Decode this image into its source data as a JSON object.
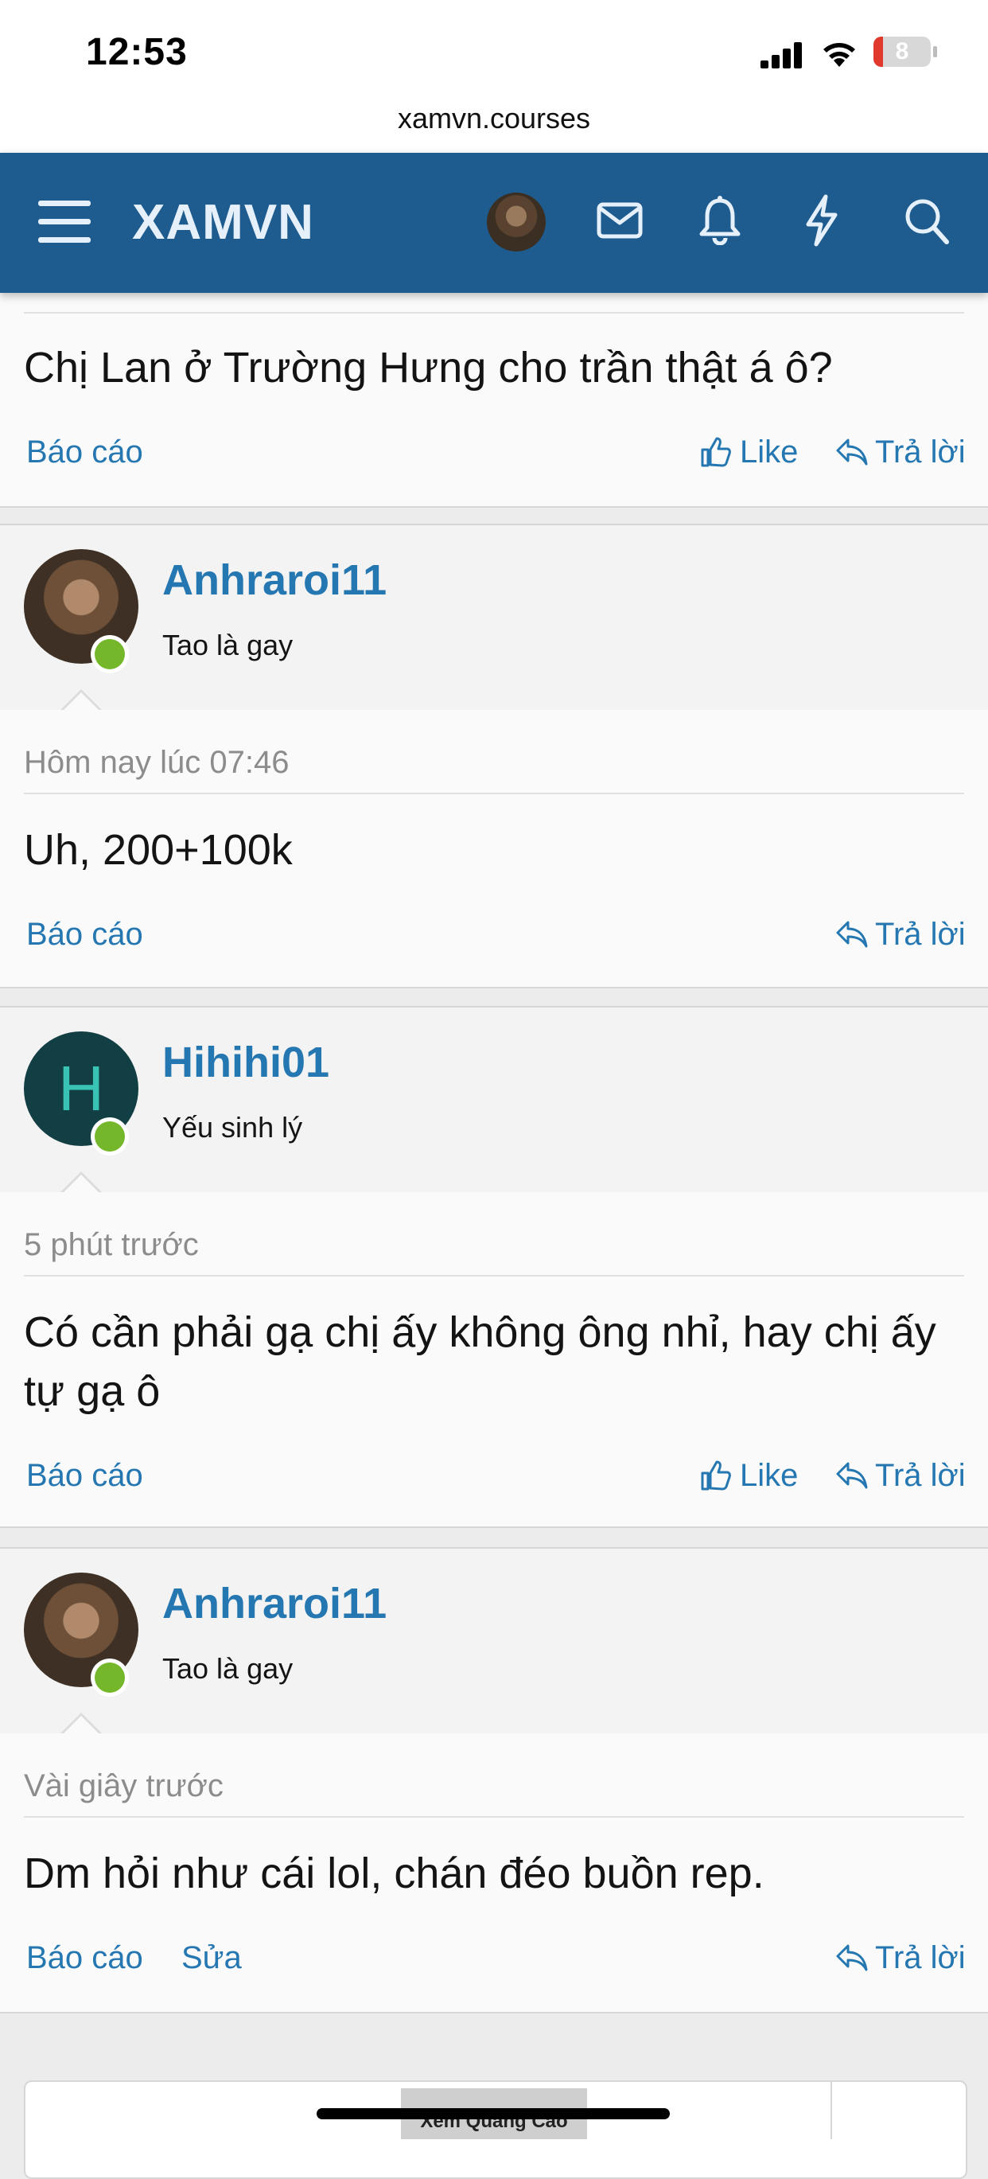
{
  "status_bar": {
    "time": "12:53",
    "battery": "8"
  },
  "browser": {
    "url": "xamvn.courses"
  },
  "header": {
    "logo": "XAMVN"
  },
  "top_post": {
    "text": "Chị Lan ở Trường Hưng cho trần thật á ô?",
    "report": "Báo cáo",
    "like": "Like",
    "reply": "Trả lời"
  },
  "posts": [
    {
      "username": "Anhraroi11",
      "user_title": "Tao là gay",
      "date": "Hôm nay lúc 07:46",
      "text": "Uh, 200+100k",
      "report": "Báo cáo",
      "reply": "Trả lời"
    },
    {
      "username": "Hihihi01",
      "avatar_letter": "H",
      "user_title": "Yếu sinh lý",
      "date": "5 phút trước",
      "text_line1": "Có cần phải gạ chị ấy không ông nhỉ, hay chị ấy",
      "text_line2": "tự gạ ô",
      "report": "Báo cáo",
      "like": "Like",
      "reply": "Trả lời"
    },
    {
      "username": "Anhraroi11",
      "user_title": "Tao là gay",
      "date": "Vài giây trước",
      "text": "Dm hỏi như cái lol, chán đéo buồn rep.",
      "report": "Báo cáo",
      "edit": "Sửa",
      "reply": "Trả lời"
    }
  ],
  "ad": {
    "label": "Xem Quảng Cáo"
  },
  "colors": {
    "header": "#1e5b8e",
    "link": "#2577b1",
    "online": "#75b72b"
  }
}
